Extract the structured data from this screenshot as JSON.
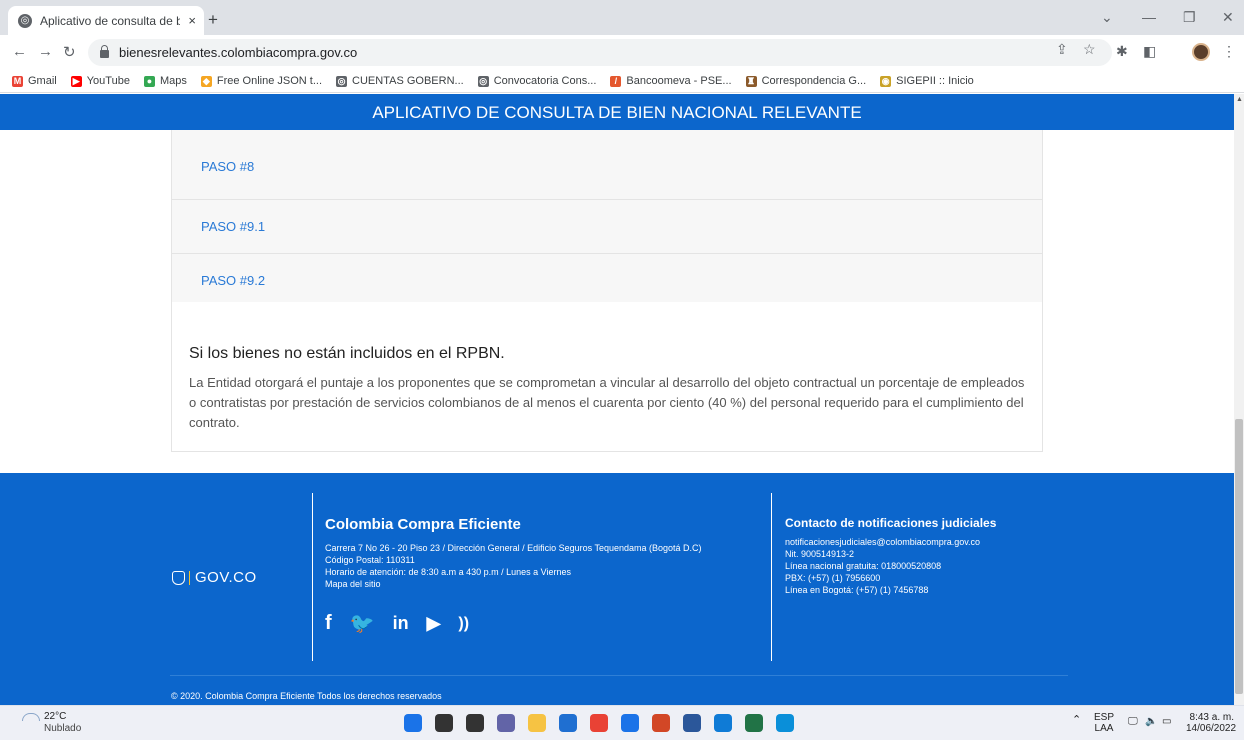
{
  "browser": {
    "tab_title": "Aplicativo de consulta de bien n",
    "tab_close": "×",
    "new_tab": "+",
    "url": "bienesrelevantes.colombiacompra.gov.co",
    "bookmarks": [
      {
        "label": "Gmail",
        "icon": "gmail-icon",
        "color": "#ea4335",
        "glyph": "M"
      },
      {
        "label": "YouTube",
        "icon": "youtube-icon",
        "color": "#ff0000",
        "glyph": "▶"
      },
      {
        "label": "Maps",
        "icon": "maps-icon",
        "color": "#34a853",
        "glyph": "●"
      },
      {
        "label": "Free Online JSON t...",
        "icon": "json-site-icon",
        "color": "#f5a623",
        "glyph": "◆"
      },
      {
        "label": "CUENTAS GOBERN...",
        "icon": "globe-icon",
        "color": "#5f6368",
        "glyph": "◎"
      },
      {
        "label": "Convocatoria Cons...",
        "icon": "globe-icon",
        "color": "#5f6368",
        "glyph": "◎"
      },
      {
        "label": "Bancoomeva - PSE...",
        "icon": "bancoomeva-icon",
        "color": "#e4572e",
        "glyph": "/"
      },
      {
        "label": "Correspondencia G...",
        "icon": "correspondencia-icon",
        "color": "#8b5a2b",
        "glyph": "♜"
      },
      {
        "label": "SIGEPII :: Inicio",
        "icon": "sigepii-icon",
        "color": "#c9a227",
        "glyph": "◉"
      }
    ]
  },
  "page": {
    "header_title": "APLICATIVO DE CONSULTA DE BIEN NACIONAL RELEVANTE",
    "steps": [
      "PASO #8",
      "PASO #9.1",
      "PASO #9.2"
    ],
    "section_title": "Si los bienes no están incluidos en el RPBN.",
    "section_body": "La Entidad otorgará el puntaje a los proponentes que se comprometan a vincular al desarrollo del objeto contractual un porcentaje de empleados o contratistas por prestación de servicios colombianos de al menos el cuarenta por ciento (40 %) del personal requerido para el cumplimiento del contrato."
  },
  "footer": {
    "gov_logo": "GOV.CO",
    "org_name": "Colombia Compra Eficiente",
    "org_lines": [
      "Carrera 7 No 26 - 20 Piso 23 / Dirección General / Edificio Seguros Tequendama (Bogotá D.C)",
      "Código Postal: 110311",
      "Horario de atención: de 8:30 a.m a 430 p.m / Lunes a Viernes",
      "Mapa del sitio"
    ],
    "social": [
      {
        "icon": "facebook-icon",
        "glyph": "f"
      },
      {
        "icon": "twitter-icon",
        "glyph": "🐦"
      },
      {
        "icon": "linkedin-icon",
        "glyph": "in"
      },
      {
        "icon": "youtube-icon",
        "glyph": "▶"
      },
      {
        "icon": "rss-icon",
        "glyph": "))"
      }
    ],
    "contact_title": "Contacto de notificaciones judiciales",
    "contact_lines": [
      "notificacionesjudiciales@colombiacompra.gov.co",
      "Nit. 900514913-2",
      "Línea nacional gratuita: 018000520808",
      "PBX: (+57) (1) 7956600",
      "Línea en Bogotá: (+57) (1) 7456788"
    ],
    "copyright": "© 2020. Colombia Compra Eficiente Todos los derechos reservados"
  },
  "taskbar": {
    "temperature": "22°C",
    "condition": "Nublado",
    "lang_top": "ESP",
    "lang_bottom": "LAA",
    "time": "8:43 a. m.",
    "date": "14/06/2022",
    "apps": [
      {
        "icon": "windows-start-icon",
        "color": "#1a73e8"
      },
      {
        "icon": "search-icon",
        "color": "#333333"
      },
      {
        "icon": "task-view-icon",
        "color": "#333333"
      },
      {
        "icon": "teams-chat-icon",
        "color": "#6264a7"
      },
      {
        "icon": "file-explorer-icon",
        "color": "#f6c343"
      },
      {
        "icon": "app-store-icon",
        "color": "#1f6fd1"
      },
      {
        "icon": "chrome-icon",
        "color": "#e94235"
      },
      {
        "icon": "calendar-app-icon",
        "color": "#1b73e8"
      },
      {
        "icon": "powerpoint-icon",
        "color": "#d24726"
      },
      {
        "icon": "word-icon",
        "color": "#2b579a"
      },
      {
        "icon": "edge-icon",
        "color": "#0f7bd6"
      },
      {
        "icon": "excel-icon",
        "color": "#217346"
      },
      {
        "icon": "snipping-tool-icon",
        "color": "#0a8fd9"
      }
    ]
  }
}
